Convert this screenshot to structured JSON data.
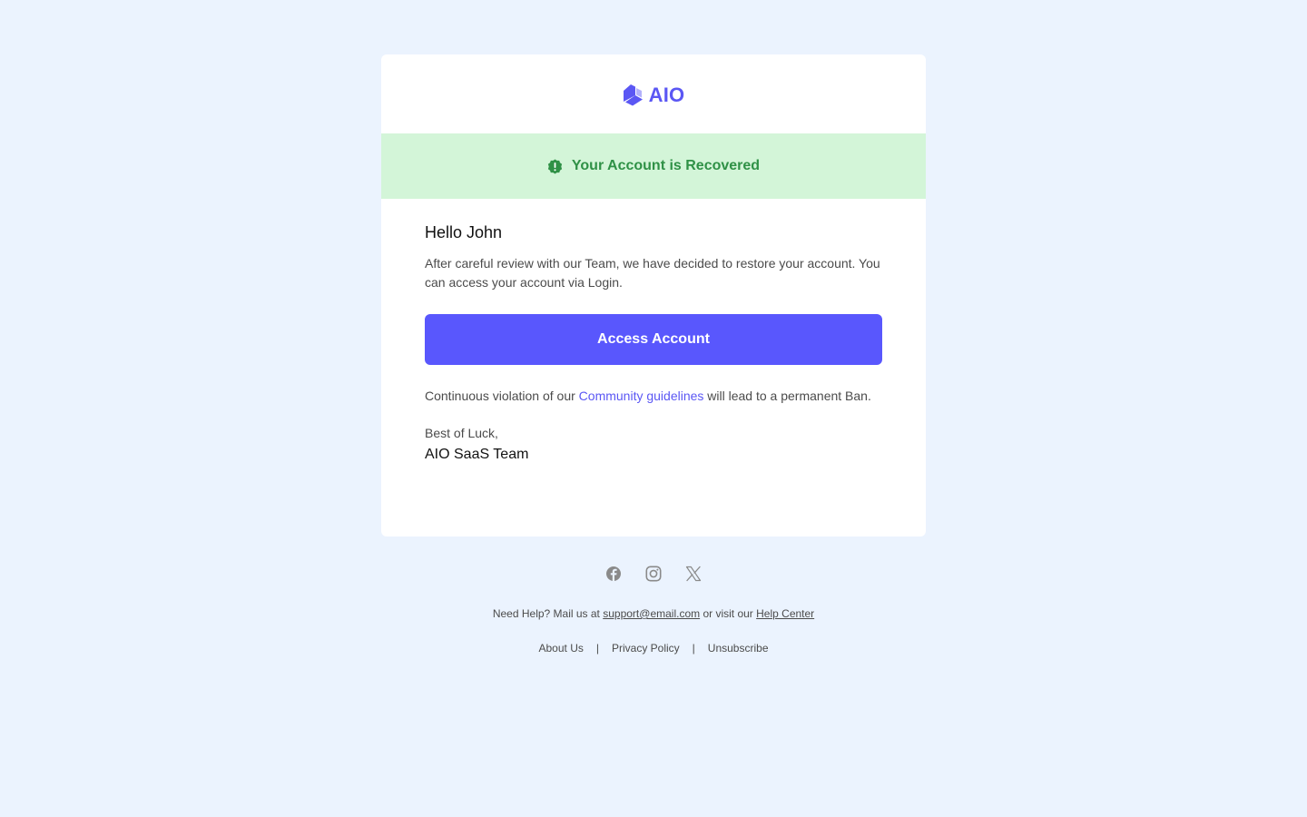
{
  "brand": {
    "name": "AIO",
    "accent": "#5b57f4"
  },
  "banner": {
    "text": "Your Account is Recovered",
    "color": "#2f9146",
    "background": "#d3f5d8",
    "icon": "alert-badge-icon"
  },
  "email": {
    "greeting": "Hello John",
    "message": "After careful review with our Team, we have decided to restore your account. You can access your account via Login.",
    "cta_label": "Access Account",
    "warning_before": "Continuous violation of our ",
    "warning_link": "Community guidelines",
    "warning_after": " will lead to a permanent Ban.",
    "signoff": "Best of Luck,",
    "team": "AIO SaaS Team"
  },
  "social": [
    {
      "name": "facebook",
      "icon": "facebook-icon"
    },
    {
      "name": "instagram",
      "icon": "instagram-icon"
    },
    {
      "name": "x",
      "icon": "x-icon"
    }
  ],
  "help": {
    "prefix": "Need Help? Mail us at ",
    "email": "support@email.com",
    "middle": " or visit our ",
    "link": "Help Center"
  },
  "footer": {
    "about": "About Us",
    "privacy": "Privacy Policy",
    "unsubscribe": "Unsubscribe",
    "separator": "|"
  }
}
